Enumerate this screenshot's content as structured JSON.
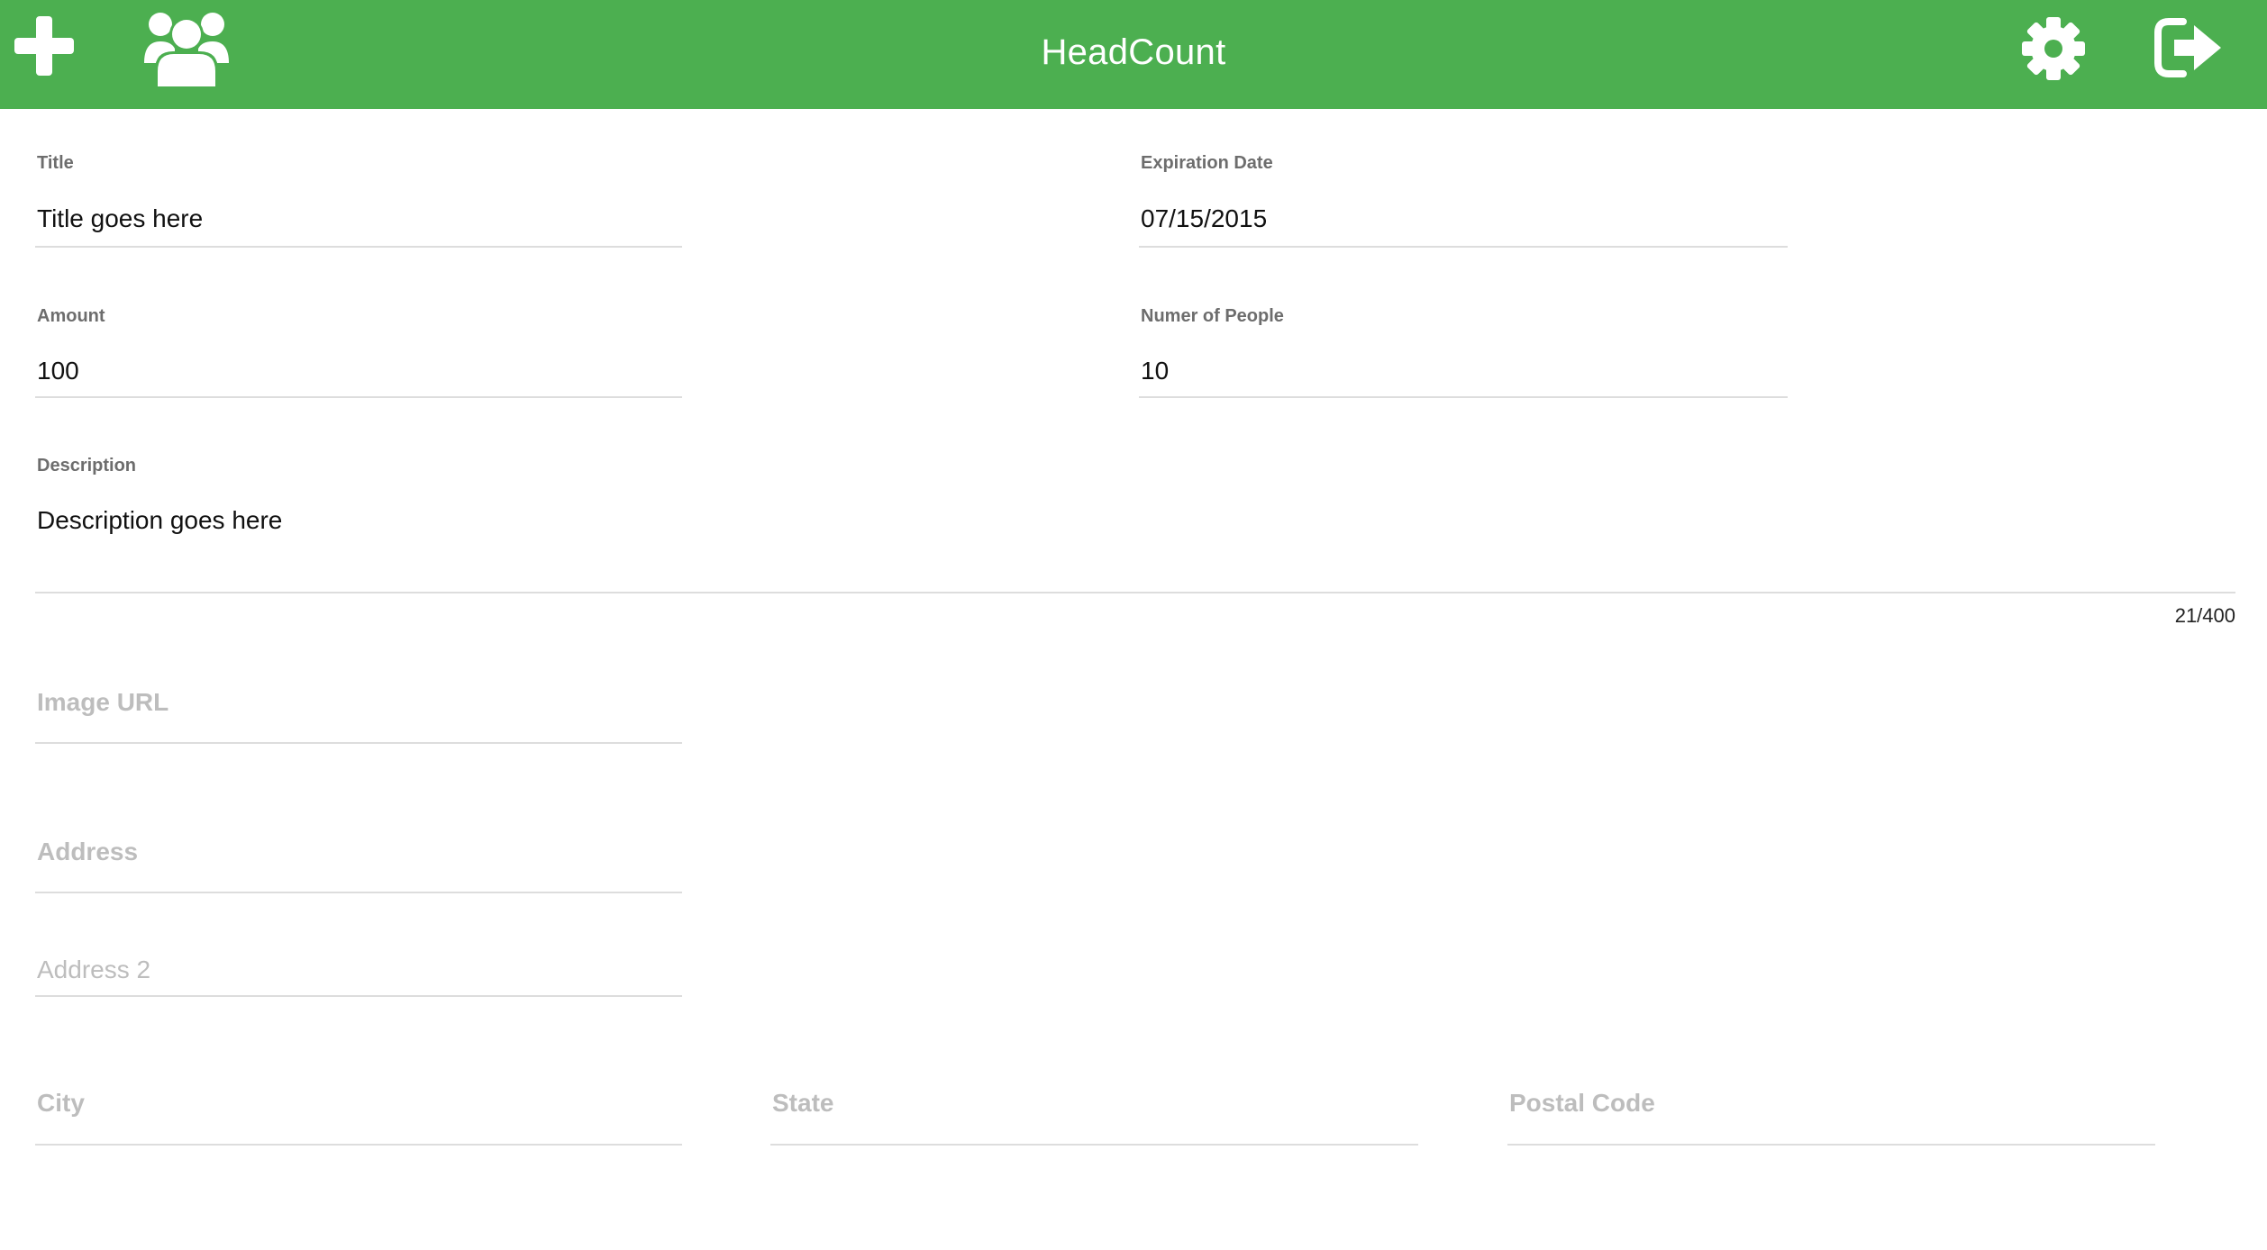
{
  "header": {
    "title": "HeadCount",
    "background_color": "#4caf50",
    "icons": {
      "left": [
        "plus-icon",
        "users-icon"
      ],
      "right": [
        "gear-icon",
        "sign-out-icon"
      ]
    }
  },
  "form": {
    "title": {
      "label": "Title",
      "value": "Title goes here"
    },
    "expiration_date": {
      "label": "Expiration Date",
      "value": "07/15/2015"
    },
    "amount": {
      "label": "Amount",
      "value": "100"
    },
    "number_of_people": {
      "label": "Numer of People",
      "value": "10"
    },
    "description": {
      "label": "Description",
      "value": "Description goes here",
      "counter": "21/400"
    },
    "image_url": {
      "placeholder": "Image URL"
    },
    "address": {
      "placeholder": "Address"
    },
    "address2": {
      "placeholder": "Address 2"
    },
    "city": {
      "placeholder": "City"
    },
    "state": {
      "placeholder": "State"
    },
    "postal_code": {
      "placeholder": "Postal Code"
    }
  }
}
